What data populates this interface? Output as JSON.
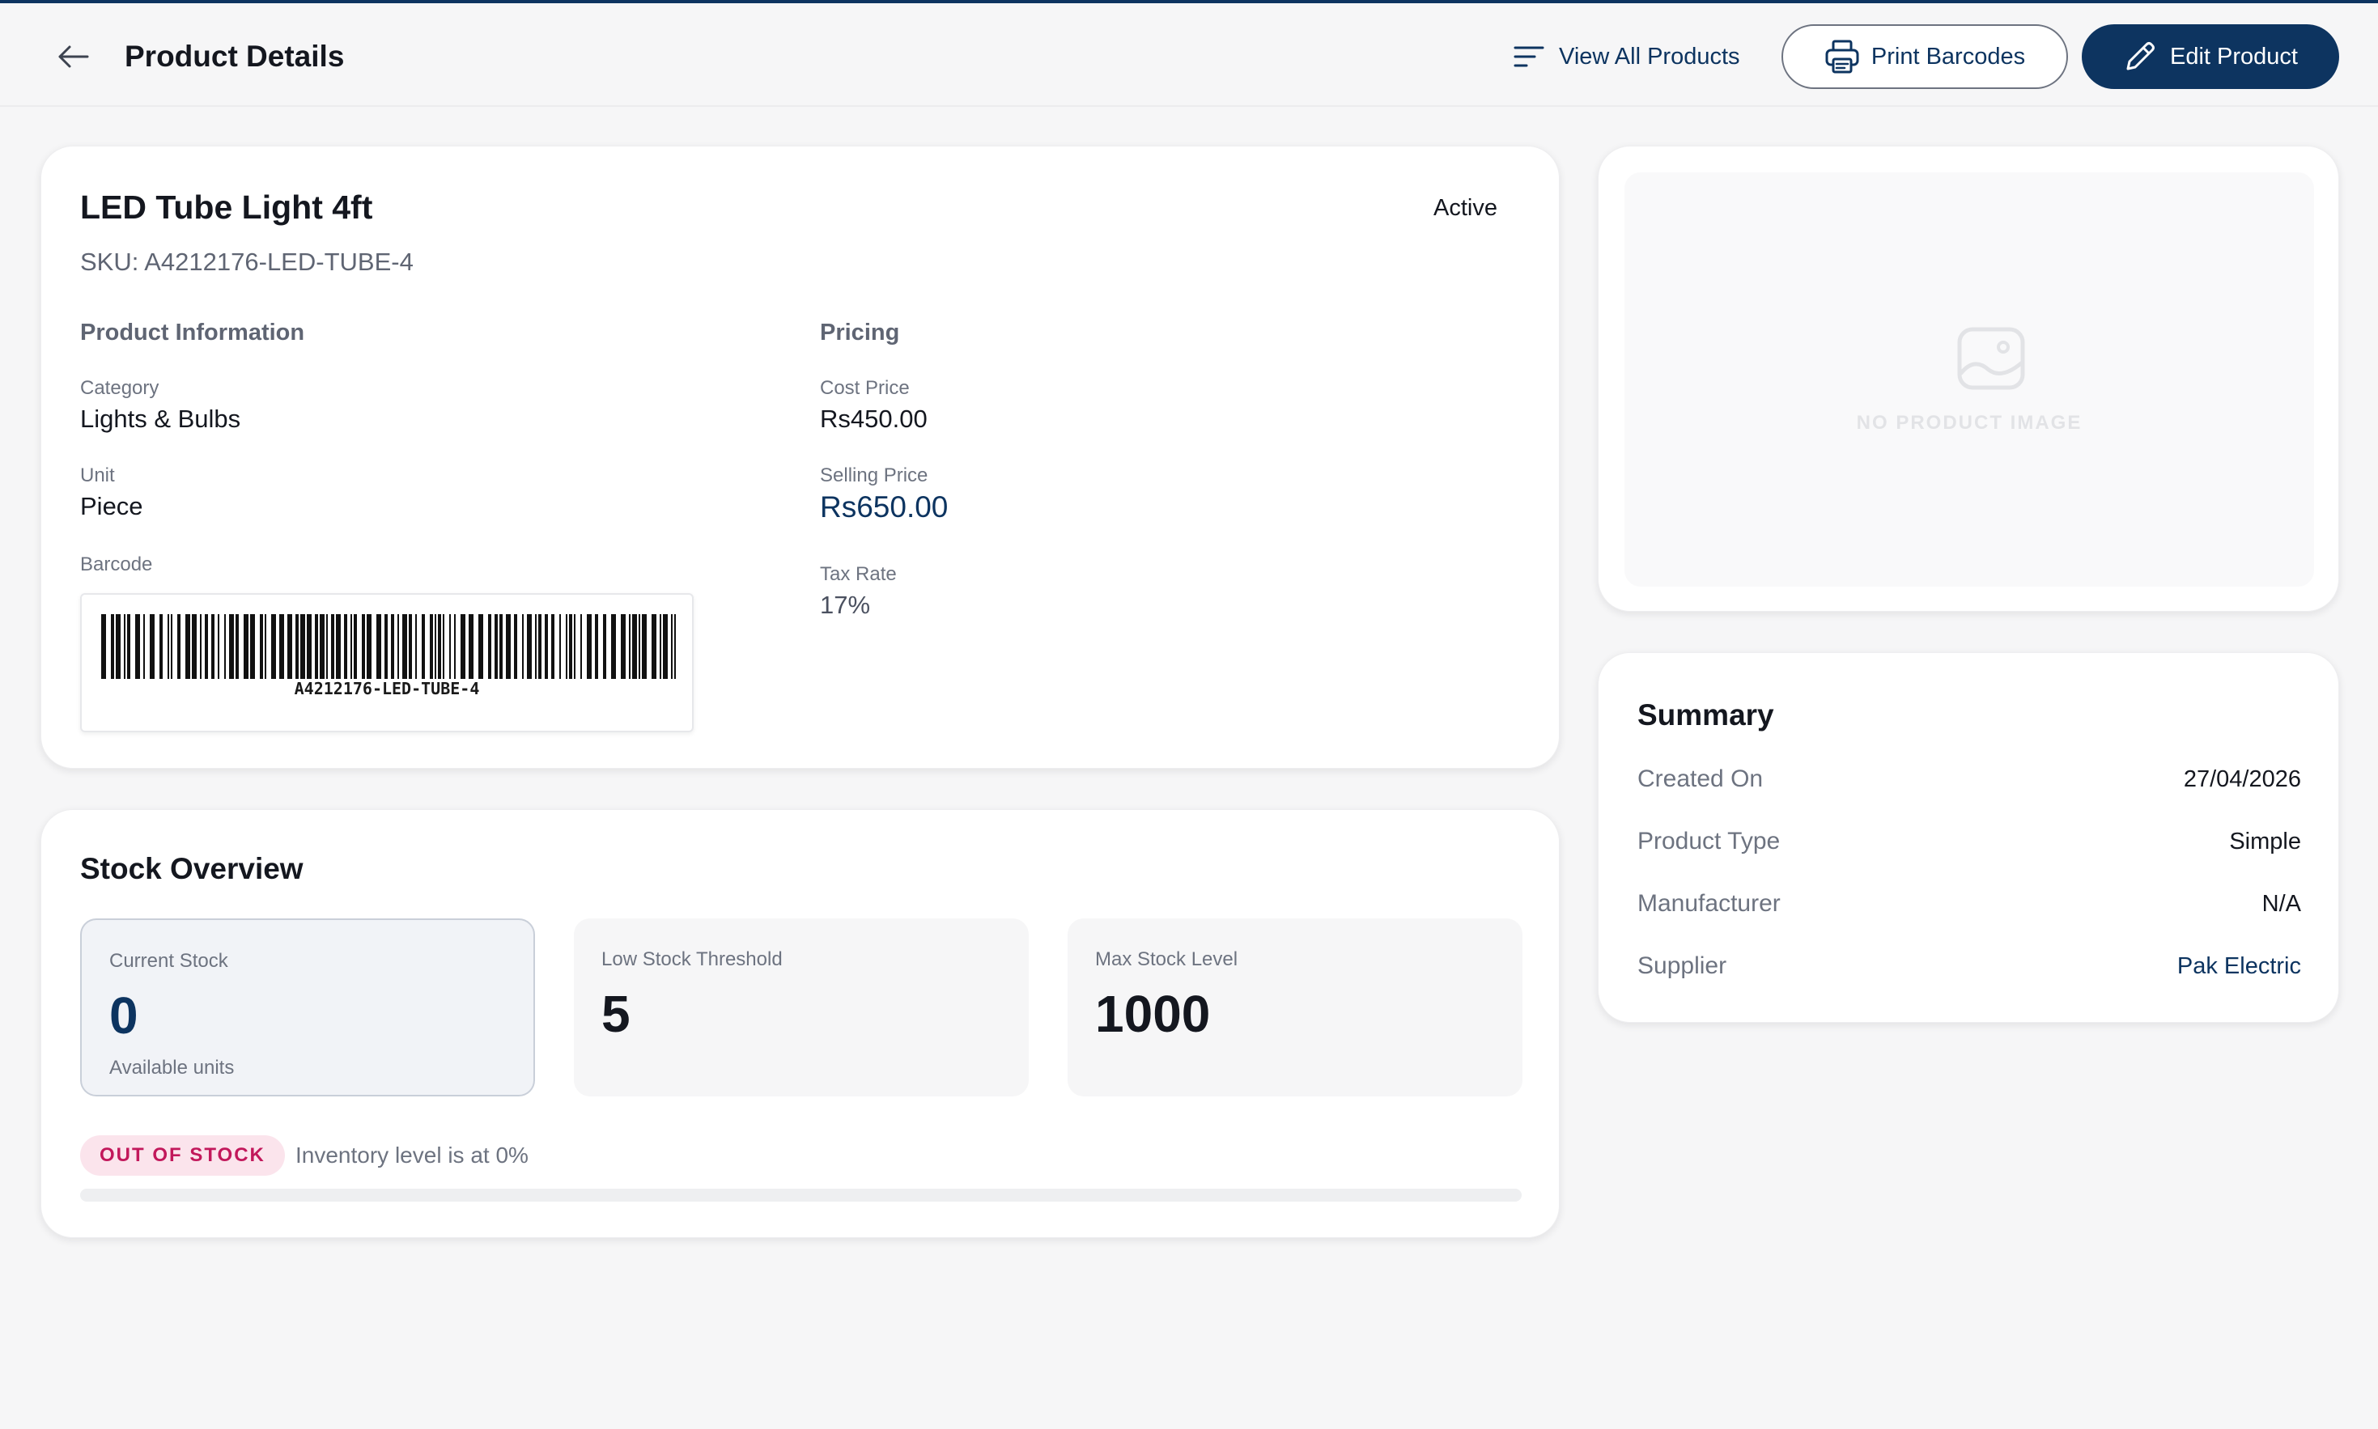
{
  "header": {
    "title": "Product Details",
    "view_all_label": "View All Products",
    "print_label": "Print Barcodes",
    "edit_label": "Edit Product"
  },
  "product": {
    "name": "LED Tube Light 4ft",
    "status": "Active",
    "sku": "SKU: A4212176-LED-TUBE-4",
    "info_heading": "Product Information",
    "category_label": "Category",
    "category": "Lights & Bulbs",
    "unit_label": "Unit",
    "unit": "Piece",
    "barcode_label": "Barcode",
    "barcode_value": "A4212176-LED-TUBE-4",
    "pricing_heading": "Pricing",
    "cost_label": "Cost Price",
    "cost": "Rs450.00",
    "selling_label": "Selling Price",
    "selling": "Rs650.00",
    "tax_label": "Tax Rate",
    "tax": "17%"
  },
  "stock": {
    "heading": "Stock Overview",
    "current_label": "Current Stock",
    "current_value": "0",
    "current_sub": "Available units",
    "low_label": "Low Stock Threshold",
    "low_value": "5",
    "max_label": "Max Stock Level",
    "max_value": "1000",
    "badge": "OUT OF STOCK",
    "inventory_text": "Inventory level is at 0%",
    "inventory_percent": 0
  },
  "image": {
    "placeholder": "NO PRODUCT IMAGE"
  },
  "summary": {
    "heading": "Summary",
    "rows": [
      {
        "key": "Created On",
        "value": "27/04/2026"
      },
      {
        "key": "Product Type",
        "value": "Simple"
      },
      {
        "key": "Manufacturer",
        "value": "N/A"
      },
      {
        "key": "Supplier",
        "value": "Pak Electric"
      }
    ]
  },
  "icons": {
    "back": "arrow-left-icon",
    "list": "list-icon",
    "print": "printer-icon",
    "edit": "pencil-icon",
    "image": "image-icon"
  },
  "colors": {
    "primary": "#0d3460",
    "danger": "#c2185b",
    "danger_bg": "#fbe4ec",
    "page_bg": "#f6f6f7"
  }
}
